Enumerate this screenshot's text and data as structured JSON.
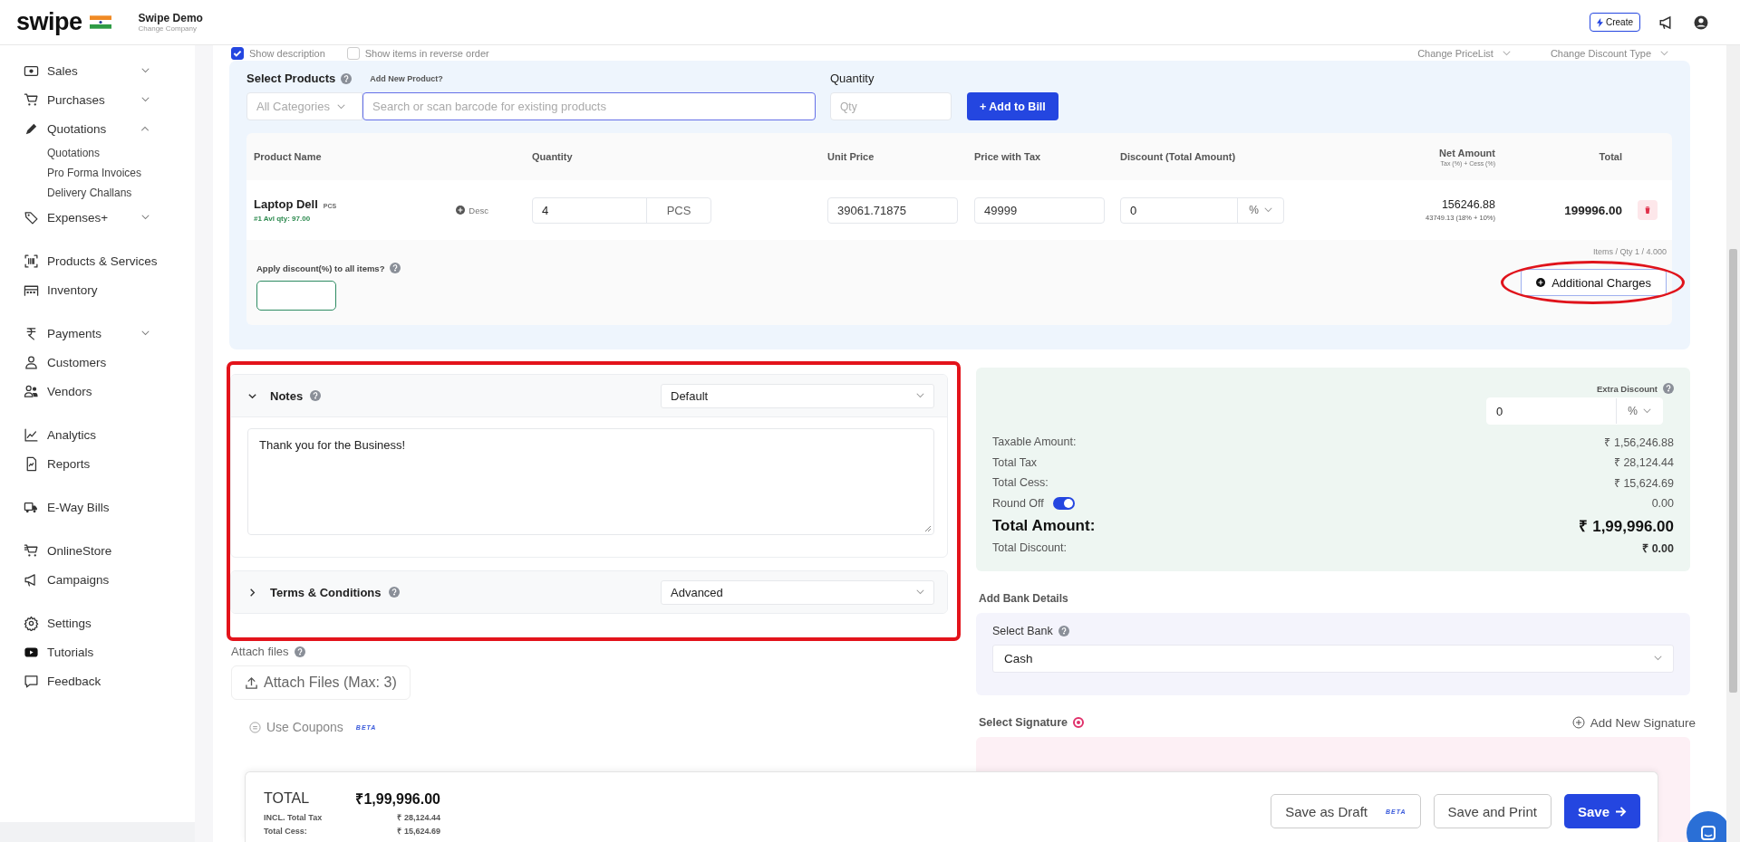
{
  "header": {
    "logo": "swipe",
    "company": "Swipe Demo",
    "change_company": "Change Company",
    "create": "Create"
  },
  "sidebar": {
    "groups": [
      [
        {
          "label": "Sales",
          "kind": "group",
          "expanded": false
        },
        {
          "label": "Purchases",
          "kind": "group",
          "expanded": false
        },
        {
          "label": "Quotations",
          "kind": "group",
          "expanded": true,
          "children": [
            {
              "label": "Quotations"
            },
            {
              "label": "Pro Forma Invoices"
            },
            {
              "label": "Delivery Challans"
            }
          ]
        },
        {
          "label": "Expenses+",
          "kind": "group",
          "expanded": false
        }
      ],
      [
        {
          "label": "Products & Services",
          "kind": "link"
        },
        {
          "label": "Inventory",
          "kind": "link"
        }
      ],
      [
        {
          "label": "Payments",
          "kind": "group",
          "expanded": false
        },
        {
          "label": "Customers",
          "kind": "link"
        },
        {
          "label": "Vendors",
          "kind": "link"
        }
      ],
      [
        {
          "label": "Analytics",
          "kind": "link"
        },
        {
          "label": "Reports",
          "kind": "link"
        }
      ],
      [
        {
          "label": "E-Way Bills",
          "kind": "link"
        }
      ],
      [
        {
          "label": "OnlineStore",
          "kind": "link"
        },
        {
          "label": "Campaigns",
          "kind": "link"
        }
      ],
      [
        {
          "label": "Settings",
          "kind": "link"
        },
        {
          "label": "Tutorials",
          "kind": "link"
        },
        {
          "label": "Feedback",
          "kind": "link"
        }
      ]
    ]
  },
  "options": {
    "checkboxes": [
      {
        "label": "Show description",
        "checked": true
      },
      {
        "label": "Show items in reverse order",
        "checked": false
      }
    ],
    "dropdowns": [
      "Change PriceList",
      "Change Discount Type"
    ]
  },
  "product_panel": {
    "title": "Select Products",
    "add_new": "Add New Product?",
    "category_placeholder": "All Categories",
    "search_placeholder": "Search or scan barcode for existing products",
    "quantity_label": "Quantity",
    "quantity_placeholder": "Qty",
    "add_button": "+ Add to Bill"
  },
  "table": {
    "columns": [
      {
        "label": "Product Name"
      },
      {
        "label": "Quantity"
      },
      {
        "label": "Unit Price"
      },
      {
        "label": "Price with Tax"
      },
      {
        "label": "Discount (Total Amount)"
      },
      {
        "label": "Net Amount",
        "sub": "Tax (%) + Cess (%)"
      },
      {
        "label": "Total"
      }
    ],
    "rows": [
      {
        "name": "Laptop Dell",
        "unit": "PCS",
        "stock": "#1 Avl qty: 97.00",
        "desc": "Desc",
        "quantity": "4",
        "quantity_unit": "PCS",
        "unit_price": "39061.71875",
        "price_with_tax": "49999",
        "discount": "0",
        "discount_type": "%",
        "net_amount": "156246.88",
        "tax_detail": "43749.13 (18% + 10%)",
        "total": "199996.00"
      }
    ],
    "apply_discount_label": "Apply discount(%) to all items?",
    "items_summary": "Items / Qty 1 / 4.000",
    "additional_charges": "Additional Charges"
  },
  "notes": {
    "title": "Notes",
    "expanded": true,
    "template": "Default",
    "text": "Thank you for the Business!"
  },
  "terms": {
    "title": "Terms & Conditions",
    "expanded": false,
    "template": "Advanced"
  },
  "attach": {
    "label": "Attach files",
    "button": "Attach Files (Max: 3)"
  },
  "coupons": {
    "label": "Use Coupons",
    "badge": "BETA"
  },
  "summary": {
    "extra_discount_label": "Extra Discount",
    "extra_discount": "0",
    "extra_discount_type": "%",
    "rows": [
      {
        "label": "Taxable Amount:",
        "value": "₹ 1,56,246.88",
        "kind": "plain"
      },
      {
        "label": "Total Tax",
        "value": "₹ 28,124.44",
        "kind": "plain"
      },
      {
        "label": "Total Cess:",
        "value": "₹ 15,624.69",
        "kind": "plain"
      },
      {
        "label": "Round Off",
        "value": "0.00",
        "kind": "toggle",
        "on": true
      },
      {
        "label": "Total Amount:",
        "value": "₹ 1,99,996.00",
        "kind": "total"
      },
      {
        "label": "Total Discount:",
        "value": "₹ 0.00",
        "kind": "strong"
      }
    ]
  },
  "bank": {
    "heading": "Add Bank Details",
    "label": "Select Bank",
    "value": "Cash"
  },
  "signature": {
    "label": "Select Signature",
    "add": "Add New Signature"
  },
  "footer": {
    "total_label": "TOTAL",
    "total": "₹1,99,996.00",
    "lines": [
      {
        "label": "INCL. Total Tax",
        "value": "₹ 28,124.44"
      },
      {
        "label": "Total Cess:",
        "value": "₹ 15,624.69"
      }
    ],
    "buttons": [
      {
        "label": "Save as Draft",
        "badge": "BETA",
        "kind": "outline"
      },
      {
        "label": "Save and Print",
        "kind": "outline"
      },
      {
        "label": "Save",
        "kind": "primary"
      }
    ]
  }
}
